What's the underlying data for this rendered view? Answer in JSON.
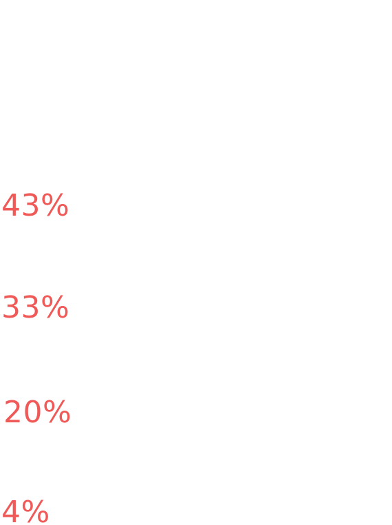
{
  "accent_color": "#ef5a58",
  "stats": [
    {
      "value": "43%"
    },
    {
      "value": "33%"
    },
    {
      "value": "20%"
    },
    {
      "value": "4%"
    }
  ]
}
